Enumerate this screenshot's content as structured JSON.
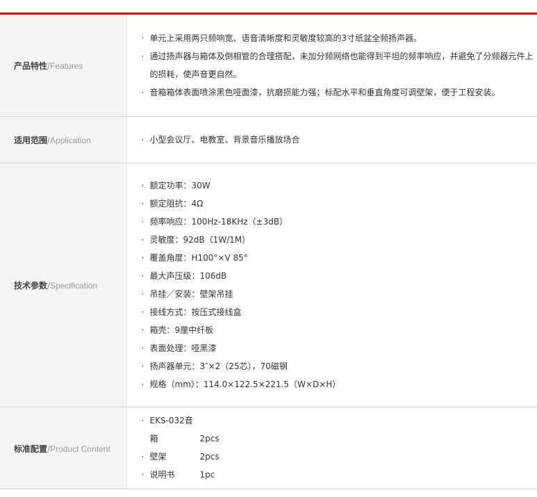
{
  "sections": [
    {
      "label_cn": "产品特性",
      "label_en": "Features",
      "items": [
        "单元上采用两只频响宽、语音清晰度和灵敏度较高的3寸纸盆全频扬声器。",
        "通过扬声器与箱体及倒相管的合理搭配，未加分频网络也能得到平坦的频率响应，并避免了分频器元件上的损耗，使声音更自然。",
        "音箱箱体表面喷涂黑色哑面漆，抗磨损能力强；标配水平和垂直角度可调壁架，便于工程安装。"
      ]
    },
    {
      "label_cn": "适用范围",
      "label_en": "Application",
      "items": [
        "小型会议厅、电教室、背景音乐播放场合"
      ]
    },
    {
      "label_cn": "技术参数",
      "label_en": "Specification",
      "items": [
        "额定功率：30W",
        "额定阻抗：4Ω",
        "频率响应：100Hz-18KHz（±3dB）",
        "灵敏度：92dB（1W/1M）",
        "覆盖角度：H100°×V 85°",
        "最大声压级：106dB",
        "吊挂／安装：壁架吊挂",
        "接线方式：按压式接线盒",
        "箱壳：9厘中纤板",
        "表面处理：哑黑漆",
        "扬声器单元：3″×2（25芯），70磁钢",
        "规格（mm）：114.0×122.5×221.5（W×D×H）"
      ]
    },
    {
      "label_cn": "标准配置",
      "label_en": "Product Content",
      "items": [
        {
          "name": "EKS-032音箱",
          "qty": "2pcs"
        },
        {
          "name": "壁架",
          "qty": "2pcs"
        },
        {
          "name": "说明书",
          "qty": "1pc"
        }
      ]
    }
  ],
  "separator": "/",
  "colors": {
    "accent_bar": "#c8161d",
    "label_bg": "#f4f4f4",
    "border": "#d4d4d4"
  }
}
